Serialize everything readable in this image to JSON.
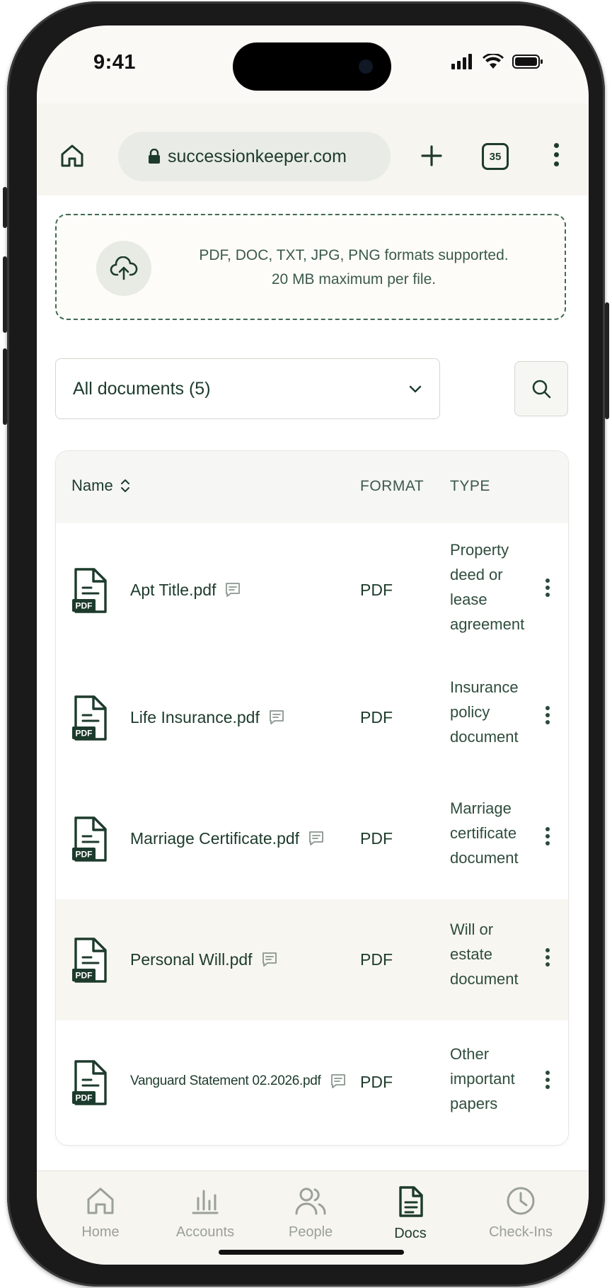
{
  "status_bar": {
    "time": "9:41"
  },
  "browser": {
    "url": "successionkeeper.com",
    "tab_count": "35"
  },
  "upload": {
    "line1": "PDF, DOC, TXT, JPG, PNG formats supported.",
    "line2": "20 MB maximum per file."
  },
  "filter": {
    "selected": "All documents (5)"
  },
  "table": {
    "headers": {
      "name": "Name",
      "format": "FORMAT",
      "type": "TYPE"
    },
    "rows": [
      {
        "name": "Apt Title.pdf",
        "format": "PDF",
        "type": "Property deed or lease agreement",
        "icon_label": "PDF"
      },
      {
        "name": "Life Insurance.pdf",
        "format": "PDF",
        "type": "Insurance policy document",
        "icon_label": "PDF"
      },
      {
        "name": "Marriage Certificate.pdf",
        "format": "PDF",
        "type": "Marriage certificate document",
        "icon_label": "PDF"
      },
      {
        "name": "Personal Will.pdf",
        "format": "PDF",
        "type": "Will or estate document",
        "icon_label": "PDF"
      },
      {
        "name": "Vanguard Statement 02.2026.pdf",
        "format": "PDF",
        "type": "Other important papers",
        "icon_label": "PDF"
      }
    ]
  },
  "nav": {
    "items": [
      {
        "label": "Home",
        "icon": "home-icon"
      },
      {
        "label": "Accounts",
        "icon": "bar-chart-icon"
      },
      {
        "label": "People",
        "icon": "people-icon"
      },
      {
        "label": "Docs",
        "icon": "document-icon",
        "active": true
      },
      {
        "label": "Check-Ins",
        "icon": "clock-icon"
      }
    ]
  },
  "colors": {
    "accent": "#1d3b2c",
    "muted": "#9aa09a",
    "highlight_row": "#f8f6f1"
  }
}
